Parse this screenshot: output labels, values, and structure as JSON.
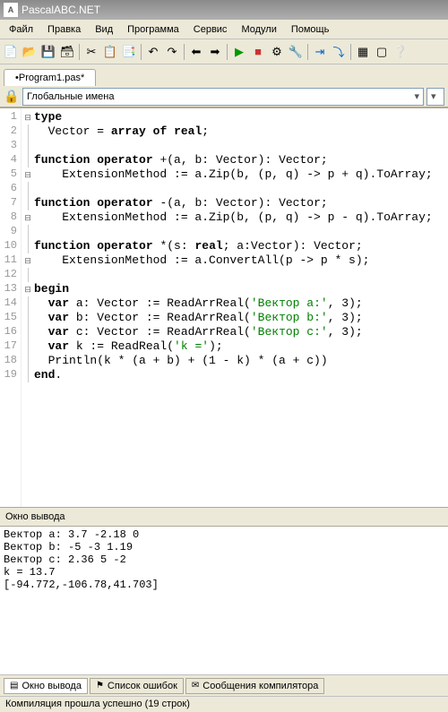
{
  "title": "PascalABC.NET",
  "menu": [
    "Файл",
    "Правка",
    "Вид",
    "Программа",
    "Сервис",
    "Модули",
    "Помощь"
  ],
  "tab": "•Program1.pas*",
  "scope": "Глобальные имена",
  "code": [
    {
      "n": "1",
      "f": "⊟",
      "t": "type"
    },
    {
      "n": "2",
      "f": "|",
      "t": "  Vector = array of real;"
    },
    {
      "n": "3",
      "f": "|",
      "t": ""
    },
    {
      "n": "4",
      "f": "|",
      "t": "function operator +(a, b: Vector): Vector;"
    },
    {
      "n": "5",
      "f": "⊟",
      "t": "    ExtensionMethod := a.Zip(b, (p, q) -> p + q).ToArray;"
    },
    {
      "n": "6",
      "f": "|",
      "t": ""
    },
    {
      "n": "7",
      "f": "|",
      "t": "function operator -(a, b: Vector): Vector;"
    },
    {
      "n": "8",
      "f": "⊟",
      "t": "    ExtensionMethod := a.Zip(b, (p, q) -> p - q).ToArray;"
    },
    {
      "n": "9",
      "f": "|",
      "t": ""
    },
    {
      "n": "10",
      "f": "|",
      "t": "function operator *(s: real; a:Vector): Vector;"
    },
    {
      "n": "11",
      "f": "⊟",
      "t": "    ExtensionMethod := a.ConvertAll(p -> p * s);"
    },
    {
      "n": "12",
      "f": "|",
      "t": ""
    },
    {
      "n": "13",
      "f": "⊟",
      "t": "begin"
    },
    {
      "n": "14",
      "f": "|",
      "t": "  var a: Vector := ReadArrReal('Вектор a:', 3);"
    },
    {
      "n": "15",
      "f": "|",
      "t": "  var b: Vector := ReadArrReal('Вектор b:', 3);"
    },
    {
      "n": "16",
      "f": "|",
      "t": "  var c: Vector := ReadArrReal('Вектор c:', 3);"
    },
    {
      "n": "17",
      "f": "|",
      "t": "  var k := ReadReal('k =');"
    },
    {
      "n": "18",
      "f": "|",
      "t": "  Println(k * (a + b) + (1 - k) * (a + c))"
    },
    {
      "n": "19",
      "f": "└",
      "t": "end."
    }
  ],
  "output_title": "Окно вывода",
  "output": "Вектор a: 3.7 -2.18 0\nВектор b: -5 -3 1.19\nВектор c: 2.36 5 -2\nk = 13.7\n[-94.772,-106.78,41.703]",
  "bottom_tabs": [
    {
      "icon": "▤",
      "label": "Окно вывода",
      "active": true
    },
    {
      "icon": "⚑",
      "label": "Список ошибок",
      "active": false
    },
    {
      "icon": "✉",
      "label": "Сообщения компилятора",
      "active": false
    }
  ],
  "status": "Компиляция прошла успешно (19 строк)"
}
